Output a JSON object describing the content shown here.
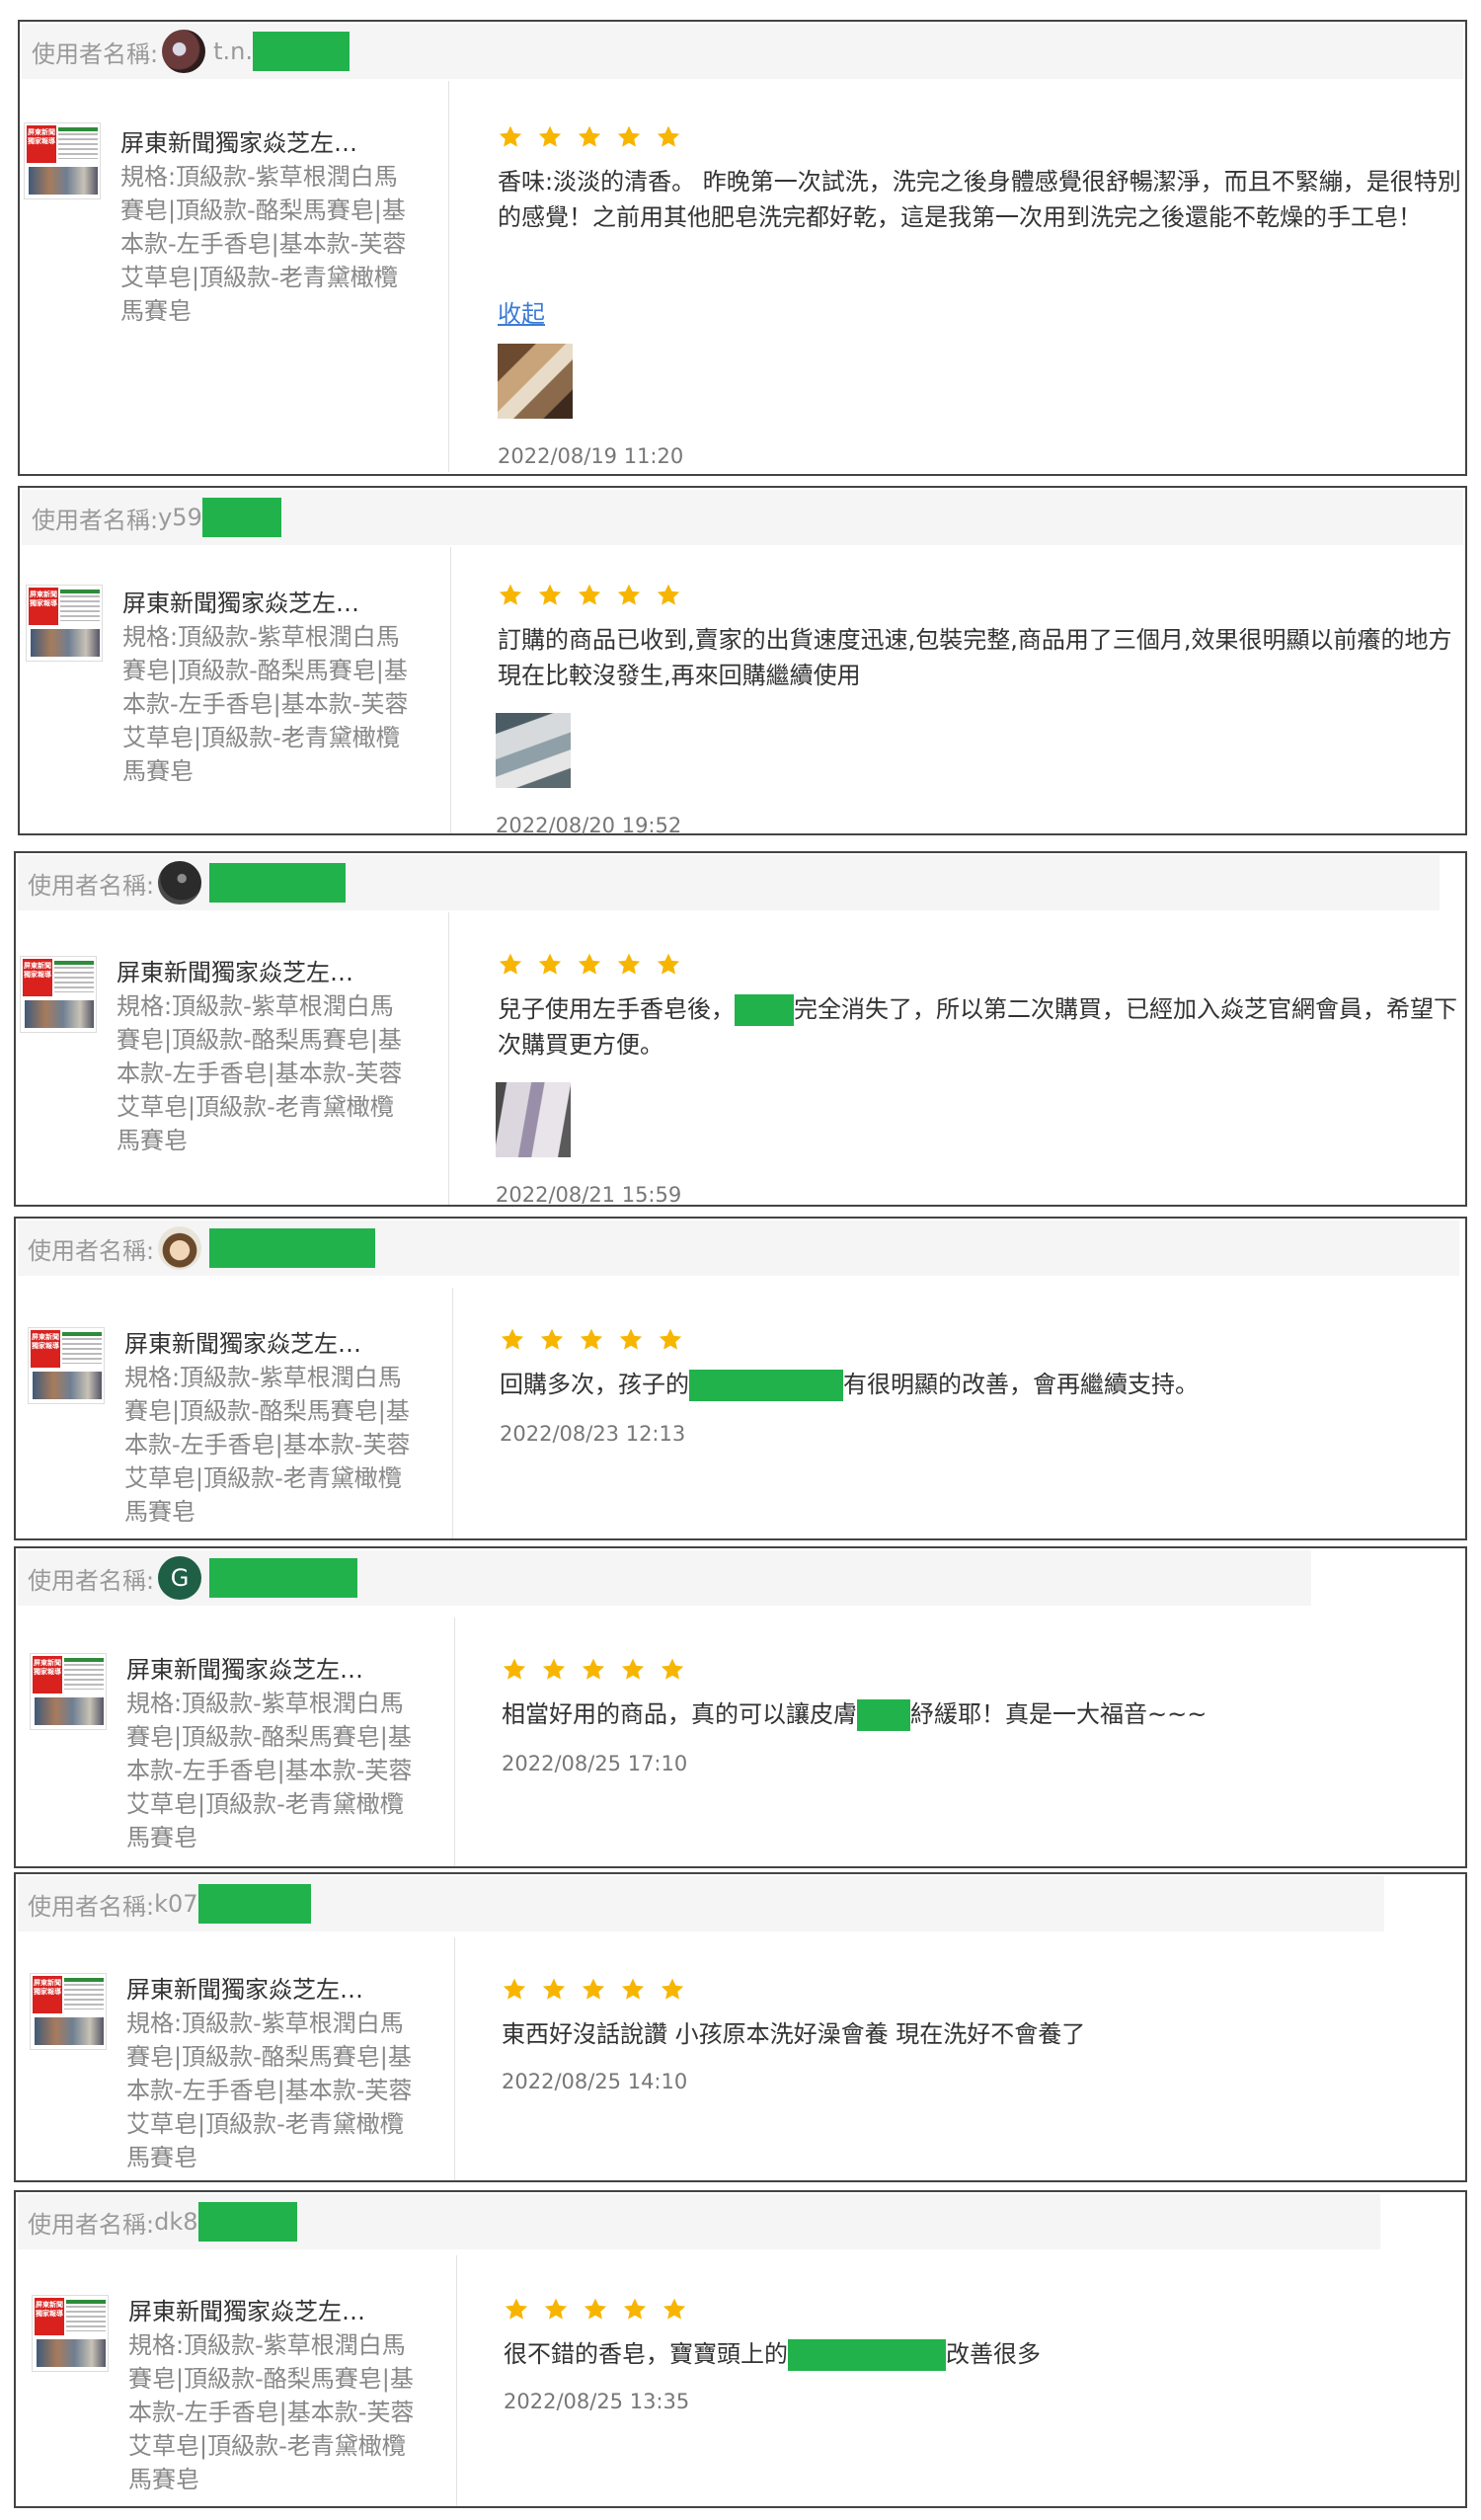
{
  "reviews": [
    {
      "label": "使用者名稱:",
      "username": "t.n.",
      "product": {
        "title": "屏東新聞獨家焱芝左…",
        "spec": "規格:頂級款-紫草根潤白馬賽皂|頂級款-酪梨馬賽皂|基本款-左手香皂|基本款-芙蓉艾草皂|頂級款-老青黛橄欖馬賽皂"
      },
      "rating": 5,
      "text_parts": [
        "香味:淡淡的清香。 昨晚第一次試洗，洗完之後身體感覺很舒暢潔淨，而且不緊繃，是很特別的感覺！之前用其他肥皂洗完都好乾，這是我第一次用到洗完之後還能不乾燥的手工皂！"
      ],
      "link": "收起",
      "date": "2022/08/19 11:20"
    },
    {
      "label": "使用者名稱:",
      "username": "y59",
      "product": {
        "title": "屏東新聞獨家焱芝左…",
        "spec": "規格:頂級款-紫草根潤白馬賽皂|頂級款-酪梨馬賽皂|基本款-左手香皂|基本款-芙蓉艾草皂|頂級款-老青黛橄欖馬賽皂"
      },
      "rating": 5,
      "text_parts": [
        "訂購的商品已收到,賣家的出貨速度迅速,包裝完整,商品用了三個月,效果很明顯以前癢的地方現在比較沒發生,再來回購繼續使用"
      ],
      "date": "2022/08/20 19:52"
    },
    {
      "label": "使用者名稱:",
      "username": "",
      "product": {
        "title": "屏東新聞獨家焱芝左…",
        "spec": "規格:頂級款-紫草根潤白馬賽皂|頂級款-酪梨馬賽皂|基本款-左手香皂|基本款-芙蓉艾草皂|頂級款-老青黛橄欖馬賽皂"
      },
      "rating": 5,
      "text_parts": [
        "兒子使用左手香皂後，",
        "完全消失了，所以第二次購買，已經加入焱芝官網會員，希望下次購買更方便。"
      ],
      "date": "2022/08/21 15:59"
    },
    {
      "label": "使用者名稱:",
      "username": "",
      "product": {
        "title": "屏東新聞獨家焱芝左…",
        "spec": "規格:頂級款-紫草根潤白馬賽皂|頂級款-酪梨馬賽皂|基本款-左手香皂|基本款-芙蓉艾草皂|頂級款-老青黛橄欖馬賽皂"
      },
      "rating": 5,
      "text_parts": [
        "回購多次，孩子的",
        "有很明顯的改善，會再繼續支持。"
      ],
      "date": "2022/08/23 12:13"
    },
    {
      "label": "使用者名稱:",
      "username": "",
      "avatar_letter": "G",
      "product": {
        "title": "屏東新聞獨家焱芝左…",
        "spec": "規格:頂級款-紫草根潤白馬賽皂|頂級款-酪梨馬賽皂|基本款-左手香皂|基本款-芙蓉艾草皂|頂級款-老青黛橄欖馬賽皂"
      },
      "rating": 5,
      "text_parts": [
        "相當好用的商品，真的可以讓皮膚",
        "紓緩耶！真是一大福音~~~"
      ],
      "date": "2022/08/25 17:10"
    },
    {
      "label": "使用者名稱:",
      "username": "k07",
      "product": {
        "title": "屏東新聞獨家焱芝左…",
        "spec": "規格:頂級款-紫草根潤白馬賽皂|頂級款-酪梨馬賽皂|基本款-左手香皂|基本款-芙蓉艾草皂|頂級款-老青黛橄欖馬賽皂"
      },
      "rating": 5,
      "text_parts": [
        "東西好沒話說讚 小孩原本洗好澡會養 現在洗好不會養了"
      ],
      "date": "2022/08/25 14:10"
    },
    {
      "label": "使用者名稱:",
      "username": "dk8",
      "product": {
        "title": "屏東新聞獨家焱芝左…",
        "spec": "規格:頂級款-紫草根潤白馬賽皂|頂級款-酪梨馬賽皂|基本款-左手香皂|基本款-芙蓉艾草皂|頂級款-老青黛橄欖馬賽皂"
      },
      "rating": 5,
      "text_parts": [
        "很不錯的香皂，寶寶頭上的",
        "改善很多"
      ],
      "date": "2022/08/25 13:35"
    }
  ],
  "colors": {
    "star": "#f7b500",
    "redaction": "#22b24c",
    "link": "#3b7cd6"
  }
}
